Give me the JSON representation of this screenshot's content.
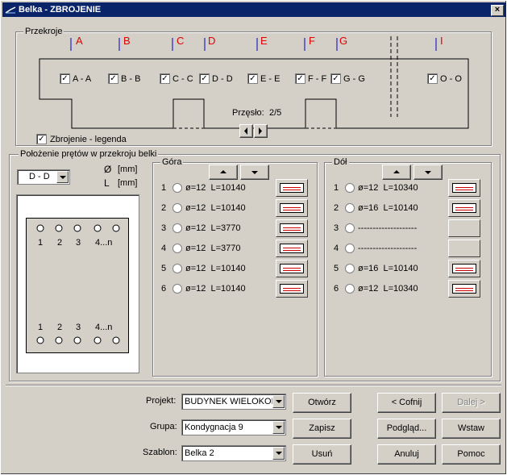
{
  "window": {
    "title": "Belka - ZBROJENIE",
    "close": "×"
  },
  "przekroje": {
    "label": "Przekroje",
    "letters": [
      "A",
      "B",
      "C",
      "D",
      "E",
      "F",
      "G",
      "I"
    ],
    "sections": [
      {
        "label": "A - A",
        "checked": true
      },
      {
        "label": "B - B",
        "checked": true
      },
      {
        "label": "C - C",
        "checked": true
      },
      {
        "label": "D - D",
        "checked": true
      },
      {
        "label": "E - E",
        "checked": true
      },
      {
        "label": "F - F",
        "checked": true
      },
      {
        "label": "G - G",
        "checked": true
      },
      {
        "label": "O - O",
        "checked": true
      }
    ],
    "span_label": "Przęsło:",
    "span_value": "2/5",
    "legend_label": "Zbrojenie - legenda",
    "legend_checked": true
  },
  "polozenie": {
    "label": "Położenie prętów w przekroju belki",
    "section_select": "D - D",
    "diam_symbol": "Ø",
    "diam_unit": "[mm]",
    "len_symbol": "L",
    "len_unit": "[mm]",
    "top_numbers": [
      "1",
      "2",
      "3",
      "4...n"
    ],
    "bottom_numbers": [
      "1",
      "2",
      "3",
      "4...n"
    ]
  },
  "gora": {
    "label": "Góra",
    "rows": [
      {
        "n": "1",
        "text": "ø=12  L=10140",
        "shape": true
      },
      {
        "n": "2",
        "text": "ø=12  L=10140",
        "shape": true
      },
      {
        "n": "3",
        "text": "ø=12  L=3770",
        "shape": true
      },
      {
        "n": "4",
        "text": "ø=12  L=3770",
        "shape": true
      },
      {
        "n": "5",
        "text": "ø=12  L=10140",
        "shape": true
      },
      {
        "n": "6",
        "text": "ø=12  L=10140",
        "shape": true
      }
    ]
  },
  "dol": {
    "label": "Dół",
    "rows": [
      {
        "n": "1",
        "text": "ø=12  L=10340",
        "shape": true
      },
      {
        "n": "2",
        "text": "ø=16  L=10140",
        "shape": true
      },
      {
        "n": "3",
        "text": "--------------------",
        "shape": false
      },
      {
        "n": "4",
        "text": "--------------------",
        "shape": false
      },
      {
        "n": "5",
        "text": "ø=16  L=10140",
        "shape": true
      },
      {
        "n": "6",
        "text": "ø=12  L=10340",
        "shape": true
      }
    ]
  },
  "bottom": {
    "projekt_label": "Projekt:",
    "projekt_value": "BUDYNEK WIELOKOND",
    "grupa_label": "Grupa:",
    "grupa_value": "Kondygnacja 9",
    "szablon_label": "Szablon:",
    "szablon_value": "Belka 2",
    "open": "Otwórz",
    "save": "Zapisz",
    "delete": "Usuń",
    "back": "< Cofnij",
    "next": "Dalej >",
    "preview": "Podgląd...",
    "insert": "Wstaw",
    "cancel": "Anuluj",
    "help": "Pomoc"
  },
  "colors": {
    "title_bg": "#0a246a",
    "letters": "#e00000",
    "marker": "#0000c0",
    "shape_line": "#cc0000"
  }
}
